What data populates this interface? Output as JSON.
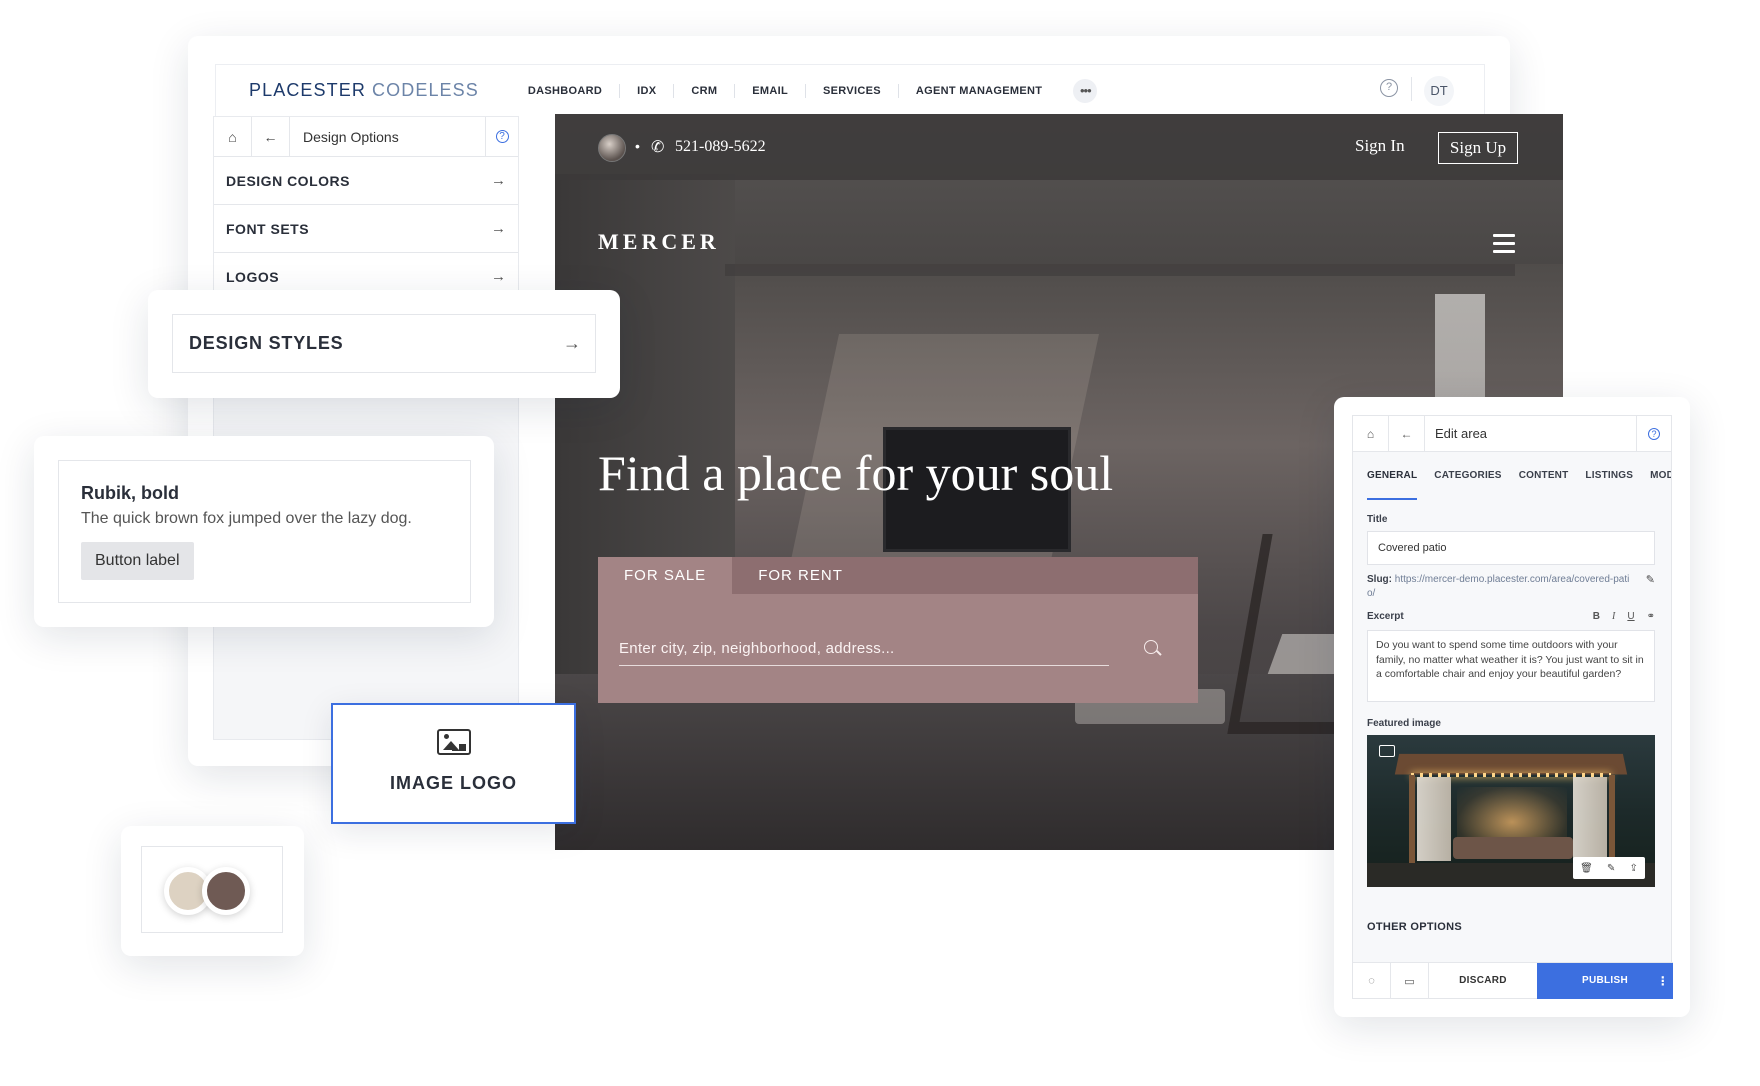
{
  "app": {
    "brand_bold": "PLACESTER",
    "brand_light": "CODELESS",
    "nav": [
      "DASHBOARD",
      "IDX",
      "CRM",
      "EMAIL",
      "SERVICES",
      "AGENT MANAGEMENT"
    ],
    "more": "•••",
    "help_icon": "question-circle-icon",
    "user_initials": "DT"
  },
  "left_panel": {
    "title": "Design Options",
    "items": [
      "DESIGN COLORS",
      "FONT SETS",
      "LOGOS"
    ]
  },
  "preview": {
    "phone": "521-089-5622",
    "sign_in": "Sign In",
    "sign_up": "Sign Up",
    "logo": "MERCER",
    "hero_title": "Find a place for your soul",
    "tabs": [
      "FOR SALE",
      "FOR RENT"
    ],
    "search_placeholder": "Enter city, zip, neighborhood, address..."
  },
  "design_styles": {
    "label": "DESIGN STYLES"
  },
  "font_card": {
    "font_name": "Rubik, bold",
    "sample": "The quick brown fox jumped over the lazy dog.",
    "button_label": "Button label"
  },
  "image_logo": {
    "label": "IMAGE LOGO"
  },
  "colors": {
    "swatch_1": "#ddd2c2",
    "swatch_2": "#6f5a54",
    "accent": "#3c6fe0"
  },
  "edit_area": {
    "title": "Edit area",
    "tabs": [
      "GENERAL",
      "CATEGORIES",
      "CONTENT",
      "LISTINGS",
      "MODU"
    ],
    "title_label": "Title",
    "title_value": "Covered patio",
    "slug_label": "Slug:",
    "slug_value": "https://mercer-demo.placester.com/area/covered-patio/",
    "excerpt_label": "Excerpt",
    "excerpt_tools": [
      "B",
      "I",
      "U"
    ],
    "excerpt_text": "Do you want to spend some time outdoors with your family, no matter what weather it is? You just want to sit in a comfortable chair and enjoy your beautiful garden?",
    "featured_label": "Featured image",
    "other_options": "OTHER OPTIONS",
    "discard": "DISCARD",
    "publish": "PUBLISH"
  }
}
